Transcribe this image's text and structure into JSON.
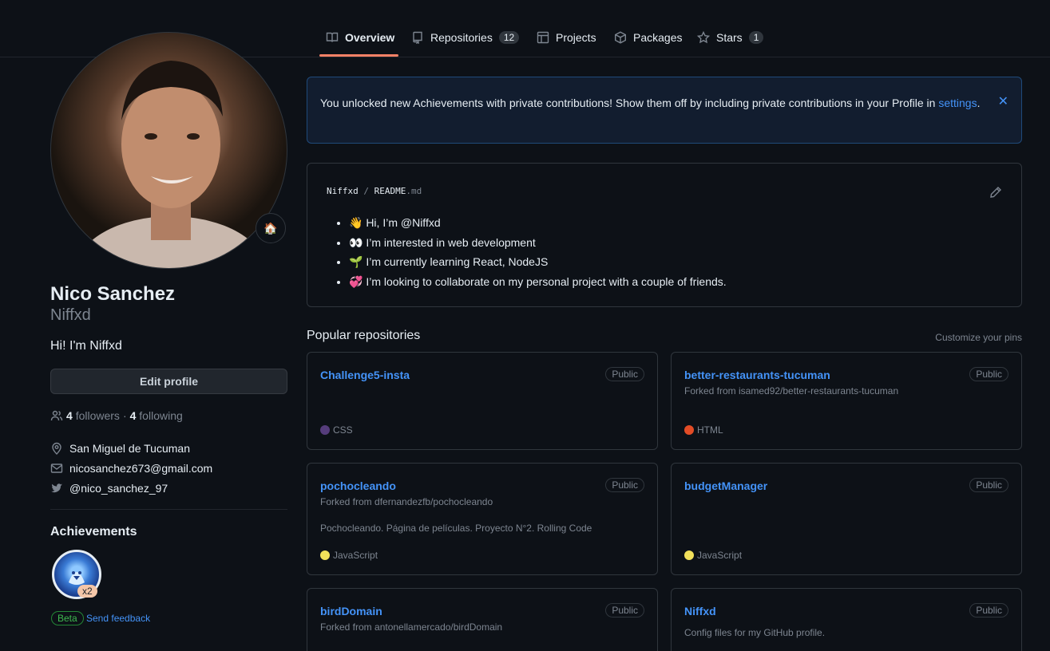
{
  "tabs": [
    {
      "label": "Overview"
    },
    {
      "label": "Repositories",
      "count": "12"
    },
    {
      "label": "Projects"
    },
    {
      "label": "Packages"
    },
    {
      "label": "Stars",
      "count": "1"
    }
  ],
  "profile": {
    "name": "Nico Sanchez",
    "login": "Niffxd",
    "bio": "Hi! I'm Niffxd",
    "status_emoji": "🏠",
    "edit_label": "Edit profile",
    "followers_count": "4",
    "followers_label": "followers",
    "separator": "·",
    "following_count": "4",
    "following_label": "following",
    "location": "San Miguel de Tucuman",
    "email": "nicosanchez673@gmail.com",
    "twitter": "@nico_sanchez_97"
  },
  "achievements": {
    "title": "Achievements",
    "badge_count": "x2",
    "beta_label": "Beta",
    "feedback_label": "Send feedback"
  },
  "banner": {
    "text": "You unlocked new Achievements with private contributions! Show them off by including private contributions in your Profile in",
    "link": "settings",
    "suffix": ".",
    "close": "✕"
  },
  "readme": {
    "owner": "Niffxd",
    "slash": "/",
    "file": "README",
    "ext": ".md",
    "items": [
      "👋 Hi, I’m @Niffxd",
      "👀 I’m interested in web development",
      "🌱 I’m currently learning React, NodeJS",
      "💞️ I’m looking to collaborate on my personal project with a couple of friends."
    ]
  },
  "popular": {
    "title": "Popular repositories",
    "customize": "Customize your pins",
    "repos": [
      {
        "name": "Challenge5-insta",
        "visibility": "Public",
        "fork": "",
        "desc": "",
        "lang": "CSS",
        "color": "#563d7c"
      },
      {
        "name": "better-restaurants-tucuman",
        "visibility": "Public",
        "fork": "Forked from isamed92/better-restaurants-tucuman",
        "desc": "",
        "lang": "HTML",
        "color": "#e34c26"
      },
      {
        "name": "pochocleando",
        "visibility": "Public",
        "fork": "Forked from dfernandezfb/pochocleando",
        "desc": "Pochocleando. Página de películas. Proyecto N°2. Rolling Code",
        "lang": "JavaScript",
        "color": "#f1e05a"
      },
      {
        "name": "budgetManager",
        "visibility": "Public",
        "fork": "",
        "desc": "",
        "lang": "JavaScript",
        "color": "#f1e05a"
      },
      {
        "name": "birdDomain",
        "visibility": "Public",
        "fork": "Forked from antonellamercado/birdDomain",
        "desc": "",
        "lang": "",
        "color": ""
      },
      {
        "name": "Niffxd",
        "visibility": "Public",
        "fork": "",
        "desc": "Config files for my GitHub profile.",
        "lang": "",
        "color": ""
      }
    ]
  }
}
